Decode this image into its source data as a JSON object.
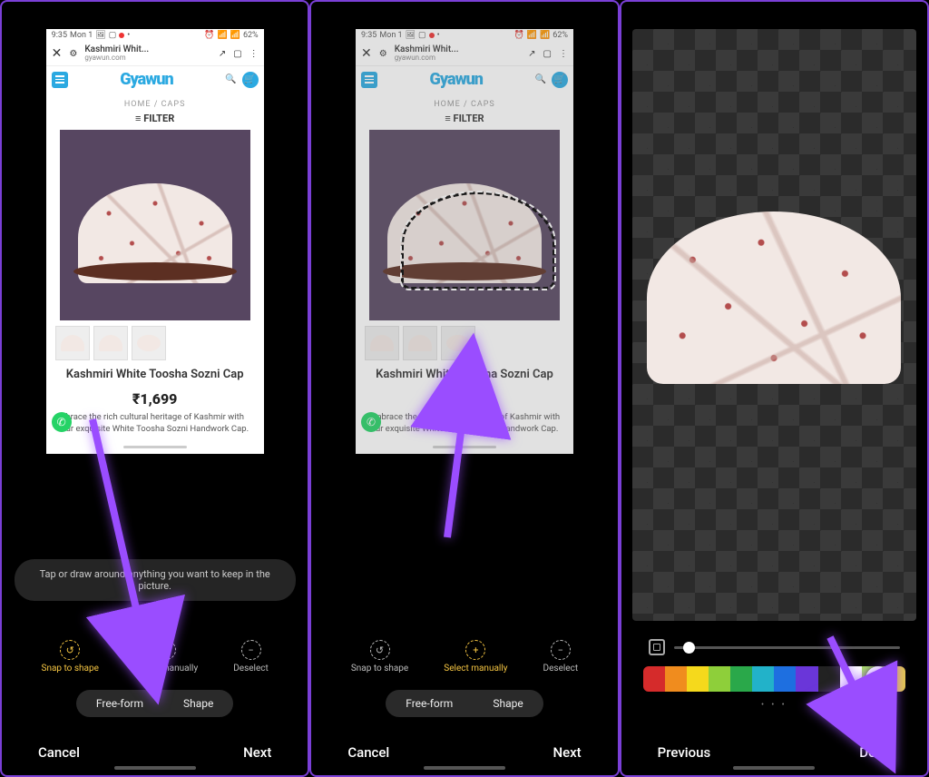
{
  "status": {
    "time": "9:35",
    "day": "Mon 1",
    "battery": "62%"
  },
  "browser": {
    "title": "Kashmiri Whit...",
    "domain": "gyawun.com"
  },
  "site": {
    "logo": "Gyawun",
    "breadcrumb_home": "HOME",
    "breadcrumb_sep": "/",
    "breadcrumb_cat": "CAPS",
    "filter": "FILTER"
  },
  "product": {
    "title": "Kashmiri White Toosha Sozni Cap",
    "price": "₹1,699",
    "desc_full": "Embrace the rich cultural heritage of Kashmir with our exquisite White Toosha Sozni Handwork Cap.",
    "desc_partial": "brace the rich cultural heritage of Kashmir with our exquisite White Toosha Sozni Handwork Cap."
  },
  "editor": {
    "tooltip": "Tap or draw around anything you want to keep in the picture.",
    "tools": {
      "snap": "Snap to shape",
      "select": "Select manually",
      "deselect": "Deselect"
    },
    "shape_modes": {
      "freeform": "Free-form",
      "shape": "Shape"
    },
    "nav": {
      "cancel": "Cancel",
      "next": "Next",
      "previous": "Previous",
      "done": "Done"
    },
    "colors": [
      "#d52b2b",
      "#f08c1e",
      "#f5d91c",
      "#8ecf3a",
      "#2aa84a",
      "#22b2c9",
      "#1e6fe0",
      "#6a36d9",
      "#222222",
      "#ffffff",
      "#a8d96a",
      "#e6c94d"
    ]
  }
}
